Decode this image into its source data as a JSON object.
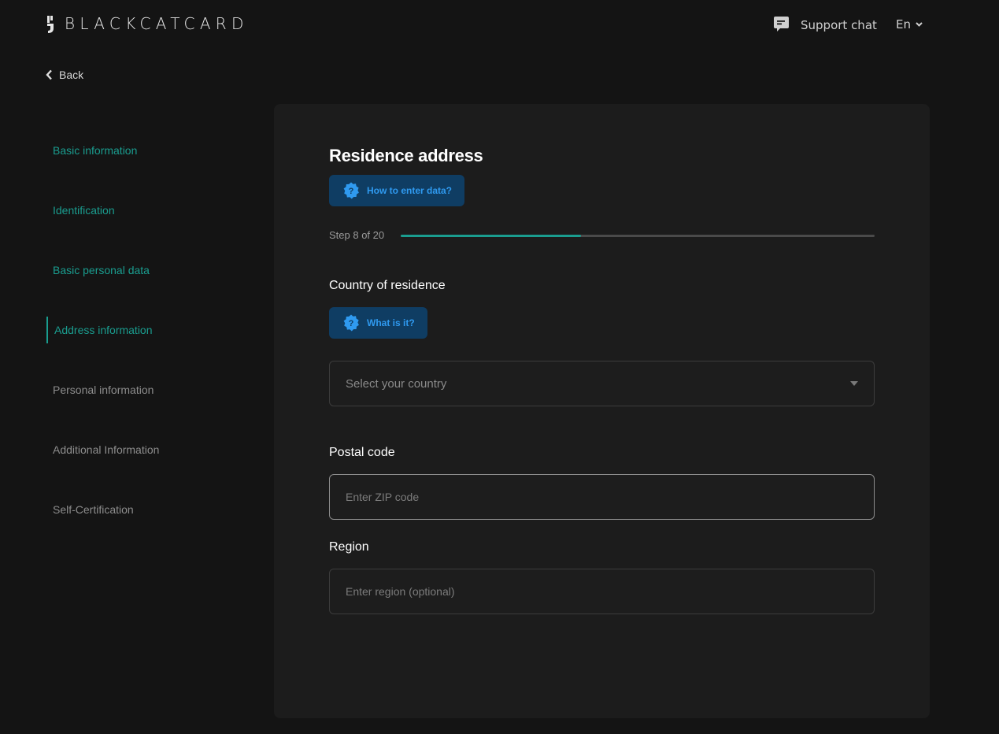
{
  "header": {
    "brand": "BLACKCATCARD",
    "support_label": "Support chat",
    "language": "En"
  },
  "nav": {
    "back_label": "Back"
  },
  "sidebar": {
    "items": [
      {
        "label": "Basic information",
        "state": "done"
      },
      {
        "label": "Identification",
        "state": "done"
      },
      {
        "label": "Basic personal data",
        "state": "done"
      },
      {
        "label": "Address information",
        "state": "active"
      },
      {
        "label": "Personal information",
        "state": "todo"
      },
      {
        "label": "Additional Information",
        "state": "todo"
      },
      {
        "label": "Self-Certification",
        "state": "todo"
      }
    ]
  },
  "form": {
    "title": "Residence address",
    "help_label": "How to enter data?",
    "step_text": "Step 8 of 20",
    "progress": 0.38,
    "country": {
      "label": "Country of residence",
      "help_label": "What is it?",
      "placeholder": "Select your country"
    },
    "postal": {
      "label": "Postal code",
      "placeholder": "Enter ZIP code"
    },
    "region": {
      "label": "Region",
      "placeholder": "Enter region (optional)"
    }
  },
  "colors": {
    "accent": "#1a9d8f",
    "help_bg": "#0f3d63",
    "help_text": "#2f9af0",
    "card_bg": "#1c1c1c",
    "page_bg": "#141414"
  },
  "icons": {
    "brand_mark": "cat-logo-icon",
    "support": "chat-bubble-icon",
    "language": "chevron-down-icon",
    "back": "chevron-left-icon",
    "help": "question-badge-icon",
    "select": "caret-down-icon"
  }
}
